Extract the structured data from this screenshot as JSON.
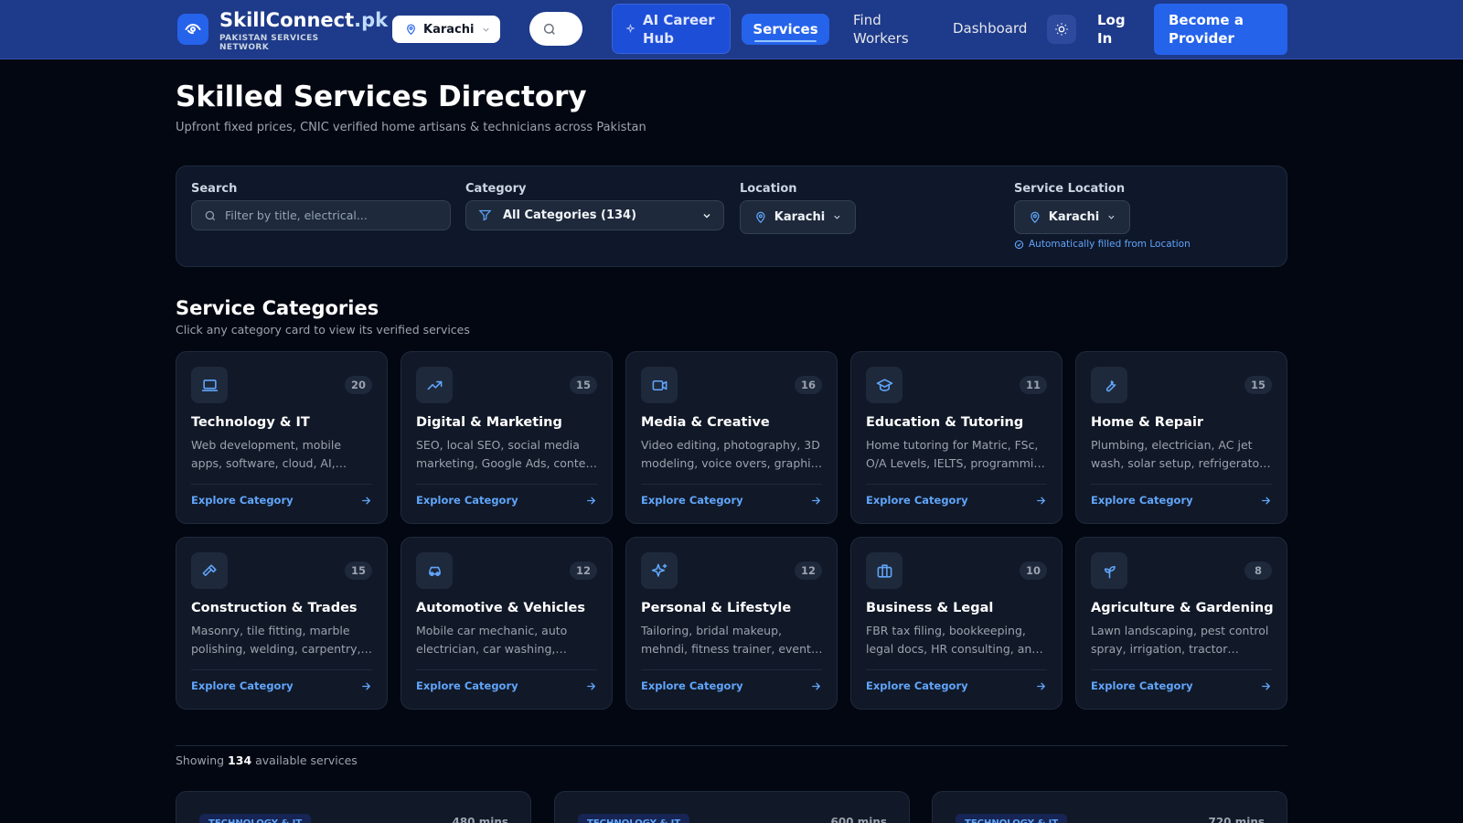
{
  "navbar": {
    "brand_main": "SkillConnect",
    "brand_tld": ".pk",
    "tagline": "PAKISTAN SERVICES NETWORK",
    "city": "Karachi",
    "ai_hub": "AI Career Hub",
    "services": "Services",
    "find_workers": "Find Workers",
    "dashboard": "Dashboard",
    "login": "Log In",
    "become_provider": "Become a Provider"
  },
  "header": {
    "title": "Skilled Services Directory",
    "subtitle": "Upfront fixed prices, CNIC verified home artisans & technicians across Pakistan"
  },
  "filters": {
    "search_label": "Search",
    "search_placeholder": "Filter by title, electrical...",
    "category_label": "Category",
    "category_value": "All Categories (134)",
    "location_label": "Location",
    "location_value": "Karachi",
    "service_location_label": "Service Location",
    "service_location_value": "Karachi",
    "auto_note": "Automatically filled from Location"
  },
  "categories_section": {
    "title": "Service Categories",
    "subtitle": "Click any category card to view its verified services",
    "explore_label": "Explore Category",
    "items": [
      {
        "name": "Technology & IT",
        "count": "20",
        "icon": "laptop-icon",
        "desc": "Web development, mobile apps, software, cloud, AI, cybersecurity"
      },
      {
        "name": "Digital & Marketing",
        "count": "15",
        "icon": "trending-up-icon",
        "desc": "SEO, local SEO, social media marketing, Google Ads, content writing"
      },
      {
        "name": "Media & Creative",
        "count": "16",
        "icon": "video-camera-icon",
        "desc": "Video editing, photography, 3D modeling, voice overs, graphic design"
      },
      {
        "name": "Education & Tutoring",
        "count": "11",
        "icon": "graduation-cap-icon",
        "desc": "Home tutoring for Matric, FSc, O/A Levels, IELTS, programming classes"
      },
      {
        "name": "Home & Repair",
        "count": "15",
        "icon": "wrench-icon",
        "desc": "Plumbing, electrician, AC jet wash, solar setup, refrigerator repair"
      },
      {
        "name": "Construction & Trades",
        "count": "15",
        "icon": "hammer-icon",
        "desc": "Masonry, tile fitting, marble polishing, welding, carpentry, painting"
      },
      {
        "name": "Automotive & Vehicles",
        "count": "12",
        "icon": "car-icon",
        "desc": "Mobile car mechanic, auto electrician, car washing, detailing"
      },
      {
        "name": "Personal & Lifestyle",
        "count": "12",
        "icon": "sparkles-icon",
        "desc": "Tailoring, bridal makeup, mehndi, fitness trainer, event planning"
      },
      {
        "name": "Business & Legal",
        "count": "10",
        "icon": "briefcase-icon",
        "desc": "FBR tax filing, bookkeeping, legal docs, HR consulting, and more"
      },
      {
        "name": "Agriculture & Gardening",
        "count": "8",
        "icon": "sprout-icon",
        "desc": "Lawn landscaping, pest control spray, irrigation, tractor services"
      }
    ]
  },
  "results": {
    "showing_prefix": "Showing",
    "count": "134",
    "showing_suffix": "available services",
    "cards": [
      {
        "tag": "TECHNOLOGY & IT",
        "duration": "480 mins"
      },
      {
        "tag": "TECHNOLOGY & IT",
        "duration": "600 mins"
      },
      {
        "tag": "TECHNOLOGY & IT",
        "duration": "720 mins"
      }
    ]
  },
  "colors": {
    "navbar": "#1e3a8a",
    "accent": "#2563eb",
    "link": "#60a5fa",
    "background": "#030712",
    "card": "#111827"
  }
}
